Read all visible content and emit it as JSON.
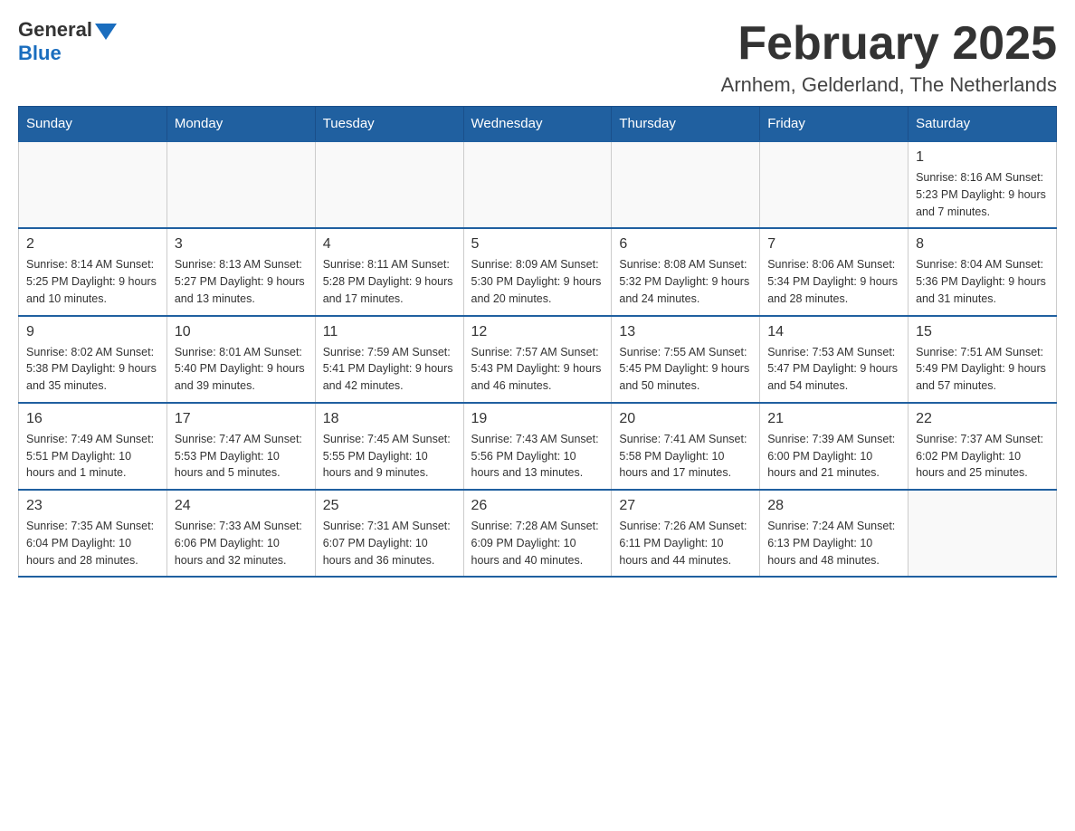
{
  "header": {
    "logo_general": "General",
    "logo_blue": "Blue",
    "month_title": "February 2025",
    "location": "Arnhem, Gelderland, The Netherlands"
  },
  "days_of_week": [
    "Sunday",
    "Monday",
    "Tuesday",
    "Wednesday",
    "Thursday",
    "Friday",
    "Saturday"
  ],
  "weeks": [
    [
      {
        "day": "",
        "info": ""
      },
      {
        "day": "",
        "info": ""
      },
      {
        "day": "",
        "info": ""
      },
      {
        "day": "",
        "info": ""
      },
      {
        "day": "",
        "info": ""
      },
      {
        "day": "",
        "info": ""
      },
      {
        "day": "1",
        "info": "Sunrise: 8:16 AM\nSunset: 5:23 PM\nDaylight: 9 hours and 7 minutes."
      }
    ],
    [
      {
        "day": "2",
        "info": "Sunrise: 8:14 AM\nSunset: 5:25 PM\nDaylight: 9 hours and 10 minutes."
      },
      {
        "day": "3",
        "info": "Sunrise: 8:13 AM\nSunset: 5:27 PM\nDaylight: 9 hours and 13 minutes."
      },
      {
        "day": "4",
        "info": "Sunrise: 8:11 AM\nSunset: 5:28 PM\nDaylight: 9 hours and 17 minutes."
      },
      {
        "day": "5",
        "info": "Sunrise: 8:09 AM\nSunset: 5:30 PM\nDaylight: 9 hours and 20 minutes."
      },
      {
        "day": "6",
        "info": "Sunrise: 8:08 AM\nSunset: 5:32 PM\nDaylight: 9 hours and 24 minutes."
      },
      {
        "day": "7",
        "info": "Sunrise: 8:06 AM\nSunset: 5:34 PM\nDaylight: 9 hours and 28 minutes."
      },
      {
        "day": "8",
        "info": "Sunrise: 8:04 AM\nSunset: 5:36 PM\nDaylight: 9 hours and 31 minutes."
      }
    ],
    [
      {
        "day": "9",
        "info": "Sunrise: 8:02 AM\nSunset: 5:38 PM\nDaylight: 9 hours and 35 minutes."
      },
      {
        "day": "10",
        "info": "Sunrise: 8:01 AM\nSunset: 5:40 PM\nDaylight: 9 hours and 39 minutes."
      },
      {
        "day": "11",
        "info": "Sunrise: 7:59 AM\nSunset: 5:41 PM\nDaylight: 9 hours and 42 minutes."
      },
      {
        "day": "12",
        "info": "Sunrise: 7:57 AM\nSunset: 5:43 PM\nDaylight: 9 hours and 46 minutes."
      },
      {
        "day": "13",
        "info": "Sunrise: 7:55 AM\nSunset: 5:45 PM\nDaylight: 9 hours and 50 minutes."
      },
      {
        "day": "14",
        "info": "Sunrise: 7:53 AM\nSunset: 5:47 PM\nDaylight: 9 hours and 54 minutes."
      },
      {
        "day": "15",
        "info": "Sunrise: 7:51 AM\nSunset: 5:49 PM\nDaylight: 9 hours and 57 minutes."
      }
    ],
    [
      {
        "day": "16",
        "info": "Sunrise: 7:49 AM\nSunset: 5:51 PM\nDaylight: 10 hours and 1 minute."
      },
      {
        "day": "17",
        "info": "Sunrise: 7:47 AM\nSunset: 5:53 PM\nDaylight: 10 hours and 5 minutes."
      },
      {
        "day": "18",
        "info": "Sunrise: 7:45 AM\nSunset: 5:55 PM\nDaylight: 10 hours and 9 minutes."
      },
      {
        "day": "19",
        "info": "Sunrise: 7:43 AM\nSunset: 5:56 PM\nDaylight: 10 hours and 13 minutes."
      },
      {
        "day": "20",
        "info": "Sunrise: 7:41 AM\nSunset: 5:58 PM\nDaylight: 10 hours and 17 minutes."
      },
      {
        "day": "21",
        "info": "Sunrise: 7:39 AM\nSunset: 6:00 PM\nDaylight: 10 hours and 21 minutes."
      },
      {
        "day": "22",
        "info": "Sunrise: 7:37 AM\nSunset: 6:02 PM\nDaylight: 10 hours and 25 minutes."
      }
    ],
    [
      {
        "day": "23",
        "info": "Sunrise: 7:35 AM\nSunset: 6:04 PM\nDaylight: 10 hours and 28 minutes."
      },
      {
        "day": "24",
        "info": "Sunrise: 7:33 AM\nSunset: 6:06 PM\nDaylight: 10 hours and 32 minutes."
      },
      {
        "day": "25",
        "info": "Sunrise: 7:31 AM\nSunset: 6:07 PM\nDaylight: 10 hours and 36 minutes."
      },
      {
        "day": "26",
        "info": "Sunrise: 7:28 AM\nSunset: 6:09 PM\nDaylight: 10 hours and 40 minutes."
      },
      {
        "day": "27",
        "info": "Sunrise: 7:26 AM\nSunset: 6:11 PM\nDaylight: 10 hours and 44 minutes."
      },
      {
        "day": "28",
        "info": "Sunrise: 7:24 AM\nSunset: 6:13 PM\nDaylight: 10 hours and 48 minutes."
      },
      {
        "day": "",
        "info": ""
      }
    ]
  ]
}
